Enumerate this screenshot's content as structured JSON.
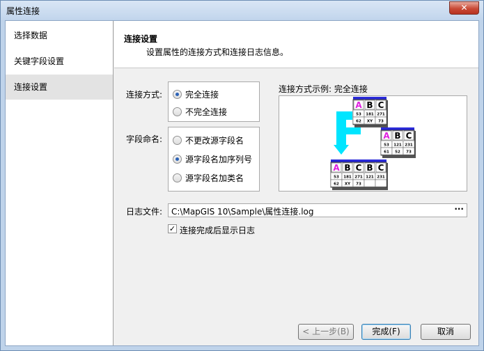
{
  "window": {
    "title": "属性连接",
    "close_glyph": "✕"
  },
  "nav": {
    "items": [
      {
        "label": "选择数据"
      },
      {
        "label": "关键字段设置"
      },
      {
        "label": "连接设置",
        "selected": true
      }
    ]
  },
  "header": {
    "title": "连接设置",
    "subtitle": "设置属性的连接方式和连接日志信息。"
  },
  "join_mode": {
    "label": "连接方式:",
    "options": [
      {
        "label": "完全连接",
        "checked": true
      },
      {
        "label": "不完全连接",
        "checked": false
      }
    ]
  },
  "field_naming": {
    "label": "字段命名:",
    "options": [
      {
        "label": "不更改源字段名",
        "checked": false
      },
      {
        "label": "源字段名加序列号",
        "checked": true
      },
      {
        "label": "源字段名加类名",
        "checked": false
      }
    ]
  },
  "example": {
    "label": "连接方式示例: 完全连接",
    "table1": {
      "headers": [
        "A",
        "B",
        "C"
      ],
      "rows": [
        [
          "53",
          "181",
          "271"
        ],
        [
          "62",
          "XY",
          "73"
        ]
      ]
    },
    "table2": {
      "headers": [
        "A",
        "B",
        "C"
      ],
      "rows": [
        [
          "53",
          "121",
          "231"
        ],
        [
          "61",
          "52",
          "73"
        ]
      ]
    },
    "table3": {
      "headers": [
        "A",
        "B",
        "C",
        "B",
        "C"
      ],
      "rows": [
        [
          "53",
          "181",
          "271",
          "121",
          "231"
        ],
        [
          "62",
          "XY",
          "73",
          "",
          ""
        ]
      ]
    }
  },
  "log": {
    "label": "日志文件:",
    "path": "C:\\MapGIS 10\\Sample\\属性连接.log",
    "browse": "···"
  },
  "show_log": {
    "label": "连接完成后显示日志",
    "checked": true,
    "mark": "✓"
  },
  "buttons": {
    "back": "< 上一步(B)",
    "finish": "完成(F)",
    "cancel": "取消"
  }
}
